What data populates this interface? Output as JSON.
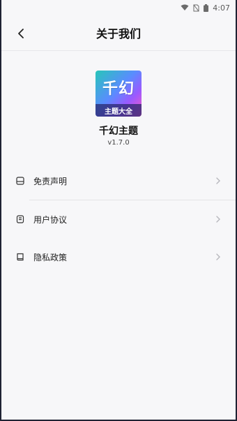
{
  "status_bar": {
    "time": "4:07"
  },
  "header": {
    "title": "关于我们"
  },
  "app": {
    "logo_top_text": "千幻",
    "logo_band_text": "主题大全",
    "name": "千幻主题",
    "version": "v1.7.0"
  },
  "menu": [
    {
      "label": "免责声明",
      "icon": "disclaimer-icon"
    },
    {
      "label": "用户协议",
      "icon": "agreement-icon"
    },
    {
      "label": "隐私政策",
      "icon": "privacy-icon"
    }
  ]
}
